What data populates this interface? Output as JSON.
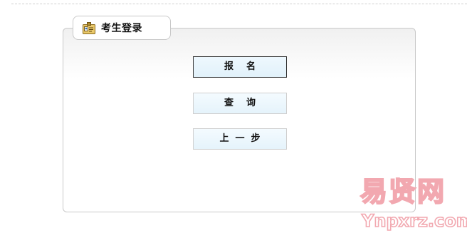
{
  "panel": {
    "title": "考生登录",
    "title_icon": "id-card-icon"
  },
  "buttons": {
    "signup_label": "报    名",
    "query_label": "查    询",
    "prev_label": "上  一  步"
  },
  "watermark": {
    "line1": "易贤网",
    "line2": "Ynpxrz.com"
  },
  "colors": {
    "panel_border": "#c9c9c9",
    "button_bg": "#e8f5fc",
    "button_active_border": "#333333",
    "watermark": "#f2a8b0"
  }
}
